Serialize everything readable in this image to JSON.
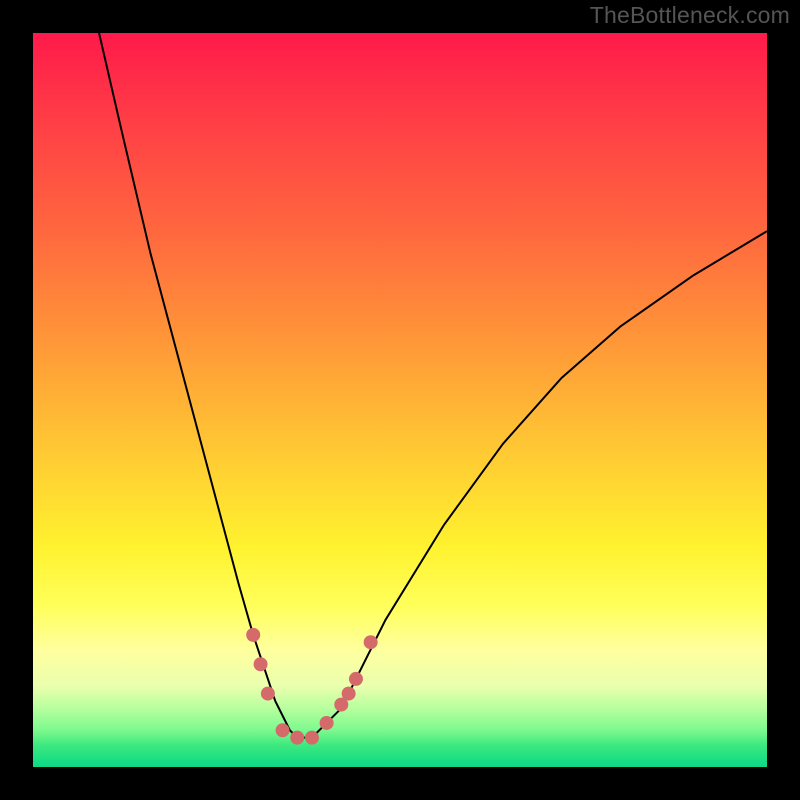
{
  "watermark": "TheBottleneck.com",
  "chart_data": {
    "type": "line",
    "title": "",
    "xlabel": "",
    "ylabel": "",
    "xlim": [
      0,
      100
    ],
    "ylim": [
      0,
      100
    ],
    "series": [
      {
        "name": "bottleneck-curve",
        "x": [
          9,
          12,
          16,
          20,
          24,
          28,
          30,
          32,
          33,
          34,
          35,
          36,
          37,
          38,
          39,
          40,
          42,
          44,
          48,
          56,
          64,
          72,
          80,
          90,
          100
        ],
        "y": [
          100,
          87,
          70,
          55,
          40,
          25,
          18,
          12,
          9,
          7,
          5,
          4,
          4,
          4,
          5,
          6,
          8,
          12,
          20,
          33,
          44,
          53,
          60,
          67,
          73
        ],
        "color": "#000000",
        "stroke_width": 2
      }
    ],
    "markers": {
      "name": "bottleneck-data-points",
      "color": "#d46a6a",
      "radius": 7,
      "points": [
        {
          "x": 30,
          "y": 18
        },
        {
          "x": 31,
          "y": 14
        },
        {
          "x": 32,
          "y": 10
        },
        {
          "x": 34,
          "y": 5
        },
        {
          "x": 36,
          "y": 4
        },
        {
          "x": 38,
          "y": 4
        },
        {
          "x": 40,
          "y": 6
        },
        {
          "x": 42,
          "y": 8.5
        },
        {
          "x": 43,
          "y": 10
        },
        {
          "x": 44,
          "y": 12
        },
        {
          "x": 46,
          "y": 17
        }
      ]
    },
    "background_gradient_stops": [
      {
        "pos": 0,
        "color": "#ff1a4b"
      },
      {
        "pos": 12,
        "color": "#ff3e46"
      },
      {
        "pos": 28,
        "color": "#ff6a3e"
      },
      {
        "pos": 42,
        "color": "#ff9738"
      },
      {
        "pos": 57,
        "color": "#ffc933"
      },
      {
        "pos": 70,
        "color": "#fff22f"
      },
      {
        "pos": 78,
        "color": "#ffff5a"
      },
      {
        "pos": 84,
        "color": "#ffff9e"
      },
      {
        "pos": 89,
        "color": "#eaffae"
      },
      {
        "pos": 92,
        "color": "#b7ff9e"
      },
      {
        "pos": 95,
        "color": "#7cf98e"
      },
      {
        "pos": 97,
        "color": "#3ee97f"
      },
      {
        "pos": 99,
        "color": "#1adf84"
      },
      {
        "pos": 100,
        "color": "#0fd886"
      }
    ]
  }
}
